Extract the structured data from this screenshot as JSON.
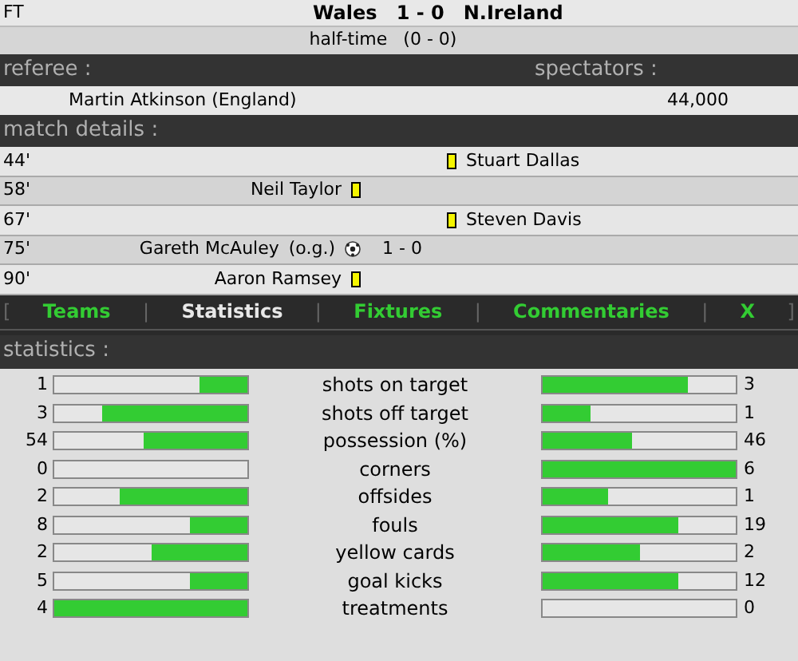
{
  "match": {
    "status": "FT",
    "home": "Wales",
    "score": "1 - 0",
    "away": "N.Ireland",
    "halftime_label": "half-time",
    "halftime_score": "(0 - 0)"
  },
  "info": {
    "referee_label": "referee :",
    "spectators_label": "spectators :",
    "referee": "Martin Atkinson (England)",
    "spectators": "44,000"
  },
  "details_label": "match details :",
  "events": [
    {
      "minute": "44'",
      "away": {
        "player": "Stuart Dallas",
        "kind": "card"
      }
    },
    {
      "minute": "58'",
      "home": {
        "player": "Neil Taylor",
        "kind": "card"
      }
    },
    {
      "minute": "67'",
      "away": {
        "player": "Steven Davis",
        "kind": "card"
      }
    },
    {
      "minute": "75'",
      "home": {
        "player": "Gareth McAuley",
        "note": "(o.g.)",
        "kind": "goal"
      },
      "score": "1 - 0"
    },
    {
      "minute": "90'",
      "home": {
        "player": "Aaron Ramsey",
        "kind": "card"
      }
    }
  ],
  "nav": {
    "open": "[",
    "close": "]",
    "separator": "|",
    "tabs": [
      {
        "label": "Teams",
        "selected": false
      },
      {
        "label": "Statistics",
        "selected": true
      },
      {
        "label": "Fixtures",
        "selected": false
      },
      {
        "label": "Commentaries",
        "selected": false
      },
      {
        "label": "X",
        "selected": false
      }
    ]
  },
  "statistics_label": "statistics :",
  "stats": [
    {
      "home": "1",
      "label": "shots on target",
      "away": "3",
      "home_bar": {
        "level": 0.25
      },
      "away_bar": {
        "level": 0.75
      }
    },
    {
      "home": "3",
      "label": "shots off target",
      "away": "1",
      "home_bar": {
        "level": 0.75
      },
      "away_bar": {
        "level": 0.25
      }
    },
    {
      "home": "54",
      "label": "possession (%)",
      "away": "46",
      "home_bar": {
        "level": 0.54
      },
      "away_bar": {
        "level": 0.46
      }
    },
    {
      "home": "0",
      "label": "corners",
      "away": "6",
      "away_bar": {
        "level": 1
      }
    },
    {
      "home": "2",
      "label": "offsides",
      "away": "1",
      "home_bar": {
        "level": 0.66
      },
      "away_bar": {
        "level": 0.34
      }
    },
    {
      "home": "8",
      "label": "fouls",
      "away": "19",
      "home_bar": {
        "level": 0.3
      },
      "away_bar": {
        "level": 0.7
      }
    },
    {
      "home": "2",
      "label": "yellow cards",
      "away": "2",
      "home_bar": {
        "level": 0.5
      },
      "away_bar": {
        "level": 0.5
      }
    },
    {
      "home": "5",
      "label": "goal kicks",
      "away": "12",
      "home_bar": {
        "level": 0.3
      },
      "away_bar": {
        "level": 0.7
      }
    },
    {
      "home": "4",
      "label": "treatments",
      "away": "0",
      "home_bar": {
        "level": 1
      }
    }
  ]
}
